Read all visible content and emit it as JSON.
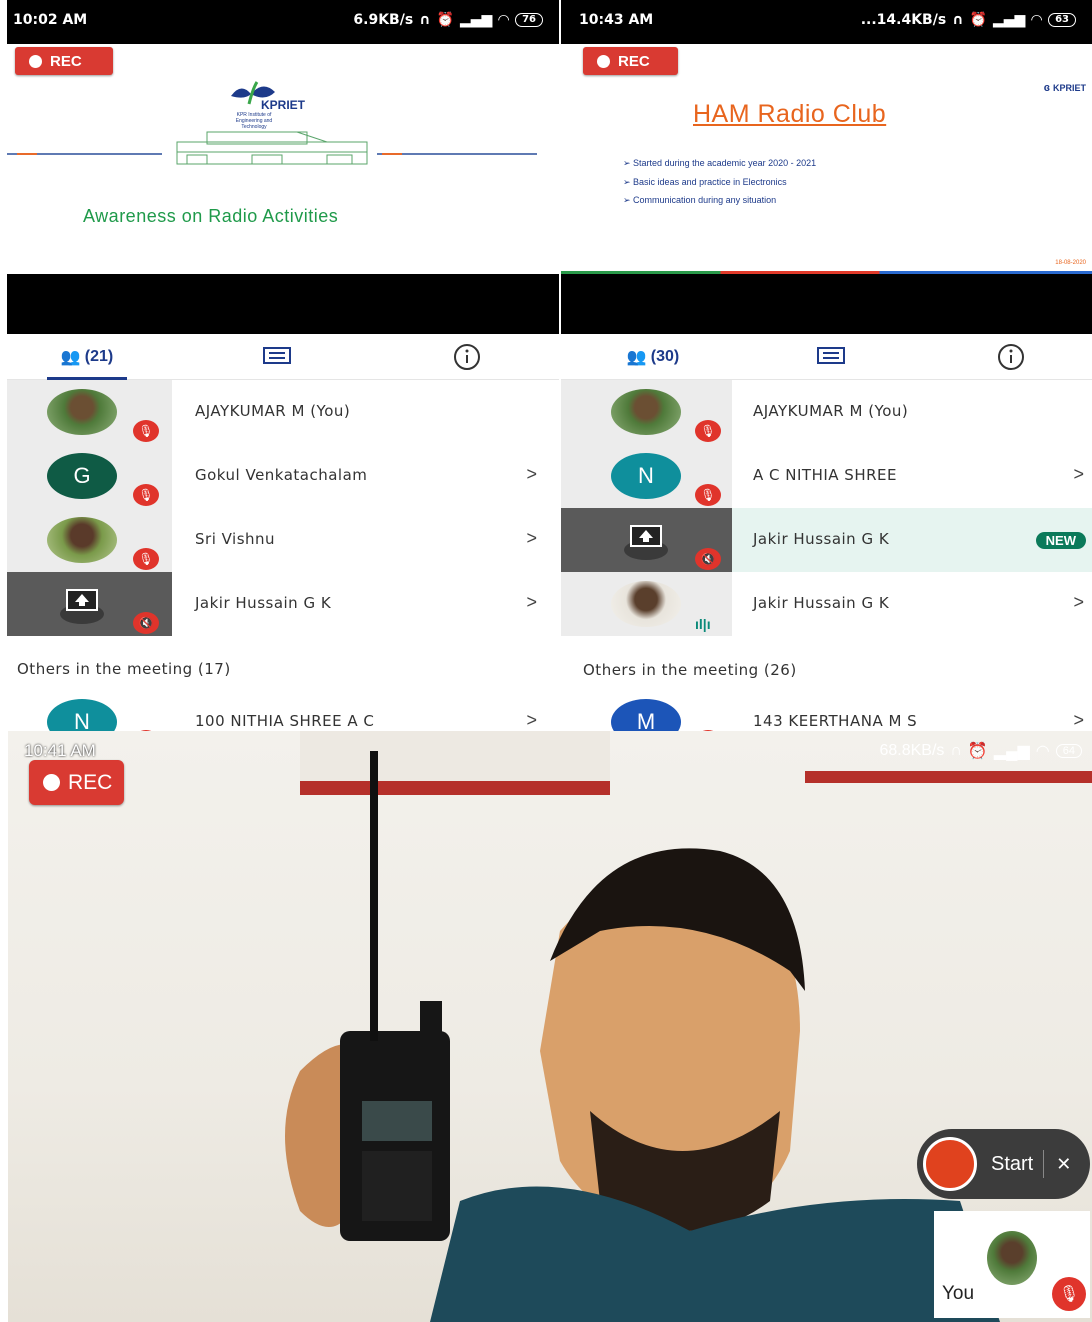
{
  "left_panel": {
    "status": {
      "time": "10:02 AM",
      "speed": "6.9KB/s",
      "battery": "76"
    },
    "rec_label": "REC",
    "slide": {
      "logo_text": "KPRIET",
      "logo_sub": "KPR Institute of Engineering and Technology",
      "title": "Awareness on Radio Activities"
    },
    "tabs": {
      "people_count": "(21)"
    },
    "participants": [
      {
        "name": "AJAYKUMAR M (You)",
        "avatar_type": "photo"
      },
      {
        "name": "Gokul Venkatachalam",
        "avatar_type": "letter",
        "letter": "G",
        "color": "#0f5b45"
      },
      {
        "name": "Sri Vishnu",
        "avatar_type": "photo"
      },
      {
        "name": "Jakir Hussain G K",
        "avatar_type": "screen"
      }
    ],
    "others_heading": "Others in the meeting (17)",
    "others": [
      {
        "name": "100 NITHIA SHREE A C",
        "letter": "N",
        "color": "#0f8f9c"
      }
    ]
  },
  "right_panel": {
    "status": {
      "time": "10:43 AM",
      "speed": "...14.4KB/s",
      "battery": "63"
    },
    "rec_label": "REC",
    "slide": {
      "logo_text": "KPRIET",
      "title": "HAM Radio Club",
      "bullets": [
        "Started during the academic year 2020 - 2021",
        "Basic ideas and practice in Electronics",
        "Communication during any situation"
      ],
      "date": "18-08-2020"
    },
    "tabs": {
      "people_count": "(30)"
    },
    "participants": [
      {
        "name": "AJAYKUMAR M (You)",
        "avatar_type": "photo"
      },
      {
        "name": "A C NITHIA SHREE",
        "avatar_type": "letter",
        "letter": "N",
        "color": "#0f8f9c"
      },
      {
        "name": "Jakir Hussain G K",
        "avatar_type": "screen",
        "badge": "NEW"
      },
      {
        "name": "Jakir Hussain G K",
        "avatar_type": "photo"
      }
    ],
    "others_heading": "Others in the meeting (26)",
    "others": [
      {
        "name": "143 KEERTHANA M S",
        "letter": "M",
        "color": "#1c55b8"
      }
    ]
  },
  "bottom_panel": {
    "status": {
      "time": "10:41 AM",
      "speed": "68.8KB/s",
      "battery": "64"
    },
    "rec_label": "REC",
    "start_label": "Start",
    "close_symbol": "✕",
    "self_label": "You"
  }
}
